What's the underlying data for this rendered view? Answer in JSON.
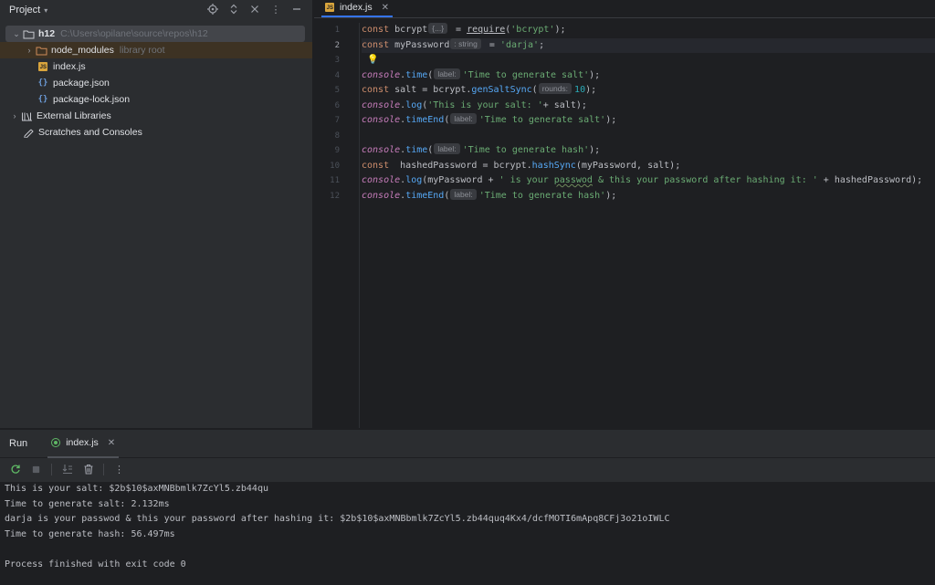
{
  "project": {
    "title": "Project",
    "root": {
      "name": "h12",
      "path": "C:\\Users\\opilane\\source\\repos\\h12"
    },
    "items": [
      {
        "label": "node_modules",
        "note": "library root"
      },
      {
        "label": "index.js"
      },
      {
        "label": "package.json"
      },
      {
        "label": "package-lock.json"
      }
    ],
    "external_libraries": "External Libraries",
    "scratches": "Scratches and Consoles"
  },
  "editor": {
    "tab": "index.js",
    "line_numbers": [
      "1",
      "2",
      "3",
      "4",
      "5",
      "6",
      "7",
      "8",
      "9",
      "10",
      "11",
      "12"
    ],
    "hints": {
      "require_hint": "{...}",
      "type_hint": ": string",
      "label": "label:",
      "rounds": "rounds:"
    },
    "code": {
      "l1": {
        "kw": "const",
        "a": " bcrypt",
        "b": " = ",
        "req": "require",
        "c": "(",
        "str": "'bcrypt'",
        "d": ");"
      },
      "l2": {
        "kw": "const",
        "a": " myPassword",
        "b": " = ",
        "str": "'darja'",
        "d": ";"
      },
      "l4": {
        "con": "console",
        "dot": ".",
        "fn": "time",
        "p": "(",
        "str": "'Time to generate salt'",
        "d": ");"
      },
      "l5": {
        "kw": "const",
        "a": " salt = bcrypt.",
        "fn": "genSaltSync",
        "p": "(",
        "num": "10",
        "d": ");"
      },
      "l6": {
        "con": "console",
        "dot": ".",
        "fn": "log",
        "p": "(",
        "str": "'This is your salt: '",
        "d": "+ salt);"
      },
      "l7": {
        "con": "console",
        "dot": ".",
        "fn": "timeEnd",
        "p": "(",
        "str": "'Time to generate salt'",
        "d": ");"
      },
      "l9": {
        "con": "console",
        "dot": ".",
        "fn": "time",
        "p": "(",
        "str": "'Time to generate hash'",
        "d": ");"
      },
      "l10": {
        "kw": "const",
        "a": "  hashedPassword = bcrypt.",
        "fn": "hashSync",
        "d": "(myPassword, salt);"
      },
      "l11": {
        "con": "console",
        "dot": ".",
        "fn": "log",
        "a": "(myPassword + ",
        "s1": "' is your ",
        "typo": "passwod",
        "s2": " & this your password after hashing it: '",
        "d": " + hashedPassword);"
      },
      "l12": {
        "con": "console",
        "dot": ".",
        "fn": "timeEnd",
        "p": "(",
        "str": "'Time to generate hash'",
        "d": ");"
      }
    }
  },
  "run": {
    "title": "Run",
    "tab": "index.js",
    "output": [
      "This is your salt: $2b$10$axMNBbmlk7ZcYl5.zb44qu",
      "Time to generate salt: 2.132ms",
      "darja is your passwod & this your password after hashing it: $2b$10$axMNBbmlk7ZcYl5.zb44quq4Kx4/dcfMOTI6mApq8CFj3o21oIWLC",
      "Time to generate hash: 56.497ms",
      "",
      "Process finished with exit code 0"
    ]
  },
  "colors": {
    "accent": "#3574f0",
    "keyword": "#cf8e6d",
    "string": "#6aab73",
    "number": "#2aacb8",
    "function": "#56a8f5",
    "console": "#c77dbb"
  }
}
